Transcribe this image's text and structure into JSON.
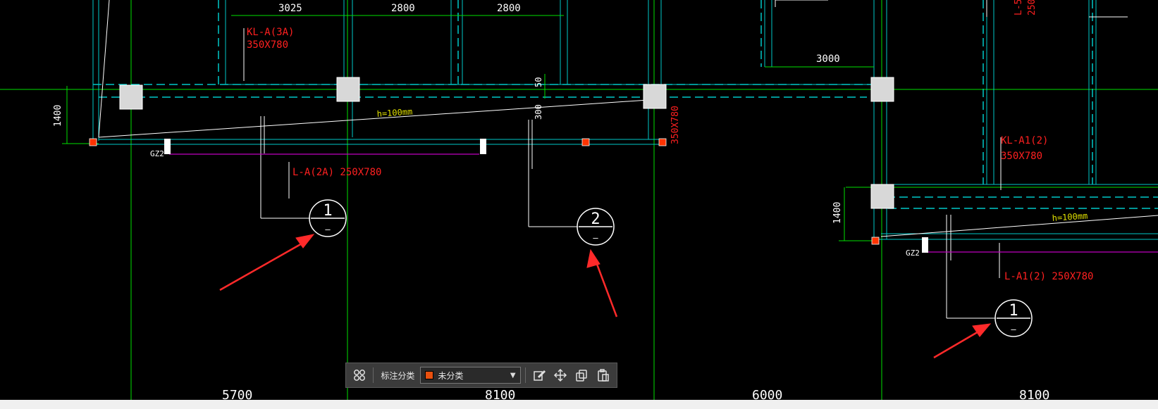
{
  "drawing": {
    "dims_top": [
      "3025",
      "2800",
      "2800"
    ],
    "dim_3000": "3000",
    "dim_1400_left": "1400",
    "dim_1400_right": "1400",
    "dim_50": "50",
    "dim_300": "300",
    "label_kl_a3a": "KL-A(3A)",
    "label_kl_a3a_size": "350X780",
    "label_350x780_vertical": "350X780",
    "label_l_a2a": "L-A(2A) 250X780",
    "label_kl_a1": "KL-A1(2)",
    "label_kl_a1_size": "350X780",
    "label_l_a1": "L-A1(2) 250X780",
    "label_l5": "L-5",
    "label_l5_num": "250",
    "label_h_left": "h=100mm",
    "label_h_right": "h=100mm",
    "label_gz2_left": "GZ2",
    "label_gz2_right": "GZ2",
    "section_marks": [
      {
        "num": "1",
        "sub": "—"
      },
      {
        "num": "2",
        "sub": "—"
      },
      {
        "num": "1",
        "sub": "—"
      }
    ],
    "bottom_dims": [
      "5700",
      "8100",
      "6000",
      "8100"
    ]
  },
  "toolbar": {
    "category_label": "标注分类",
    "category_value": "未分类",
    "category_color": "#e8500f"
  },
  "colors": {
    "background": "#000000",
    "axis_green": "#00e000",
    "wall_cyan": "#00cccc",
    "text_red": "#ff2020",
    "text_yellow": "#e0e000",
    "magenta": "#c000c0",
    "arrow_red": "#ff3030"
  },
  "icons": [
    "grid-icon",
    "edit-icon",
    "move-icon",
    "copy-icon",
    "paste-icon",
    "caret-down-icon"
  ]
}
